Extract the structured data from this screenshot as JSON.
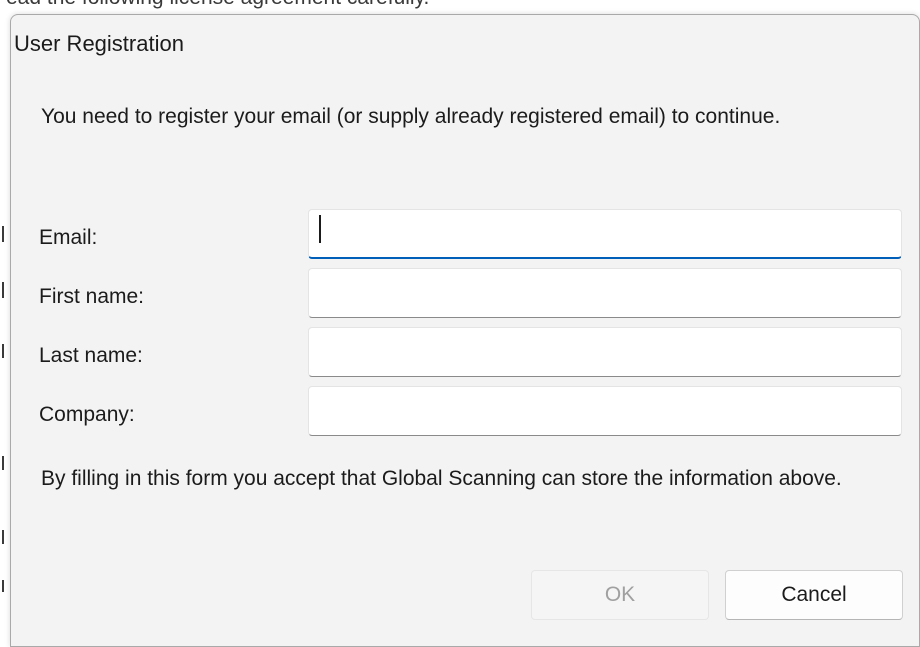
{
  "background": {
    "partial_text": "ead the following license agreement carefully."
  },
  "dialog": {
    "title": "User Registration",
    "intro": "You need to register your email (or supply already registered email) to continue.",
    "fields": [
      {
        "label": "Email:",
        "value": "",
        "focused": true
      },
      {
        "label": "First name:",
        "value": ""
      },
      {
        "label": "Last name:",
        "value": ""
      },
      {
        "label": "Company:",
        "value": ""
      }
    ],
    "notice": "By filling in this form you accept that Global Scanning can store the information above.",
    "buttons": {
      "ok": {
        "label": "OK",
        "enabled": false
      },
      "cancel": {
        "label": "Cancel",
        "enabled": true
      }
    }
  },
  "colors": {
    "accent": "#005fb8",
    "dialog_bg": "#f3f3f3",
    "disabled_text": "#a0a0a0"
  }
}
